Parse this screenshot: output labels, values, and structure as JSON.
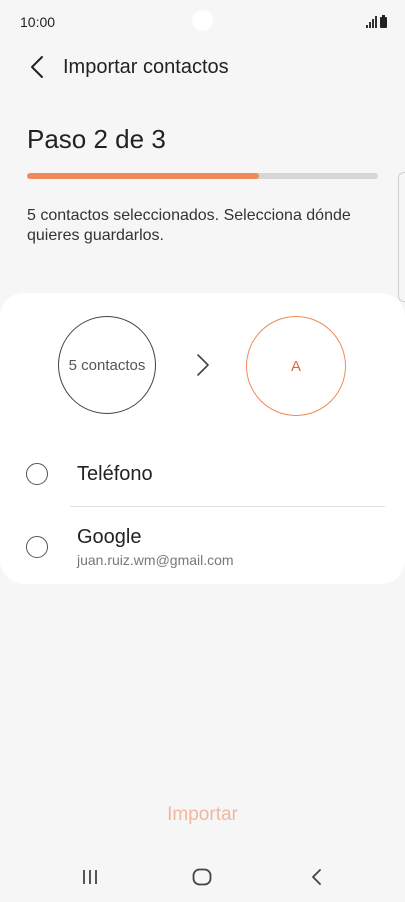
{
  "status_bar": {
    "time": "10:00"
  },
  "app_bar": {
    "title": "Importar contactos"
  },
  "step": {
    "title": "Paso 2 de 3",
    "progress": 0.66
  },
  "description": "5 contactos seleccionados. Selecciona dónde quieres guardarlos.",
  "transfer": {
    "source_label": "5 contactos",
    "target_label": "A"
  },
  "options": [
    {
      "label": "Teléfono",
      "subtitle": ""
    },
    {
      "label": "Google",
      "subtitle": "juan.ruiz.wm@gmail.com"
    }
  ],
  "import_label": "Importar",
  "colors": {
    "accent": "#ef8a5c",
    "accent_text": "#d8683a",
    "import_disabled": "#efb8a0"
  }
}
